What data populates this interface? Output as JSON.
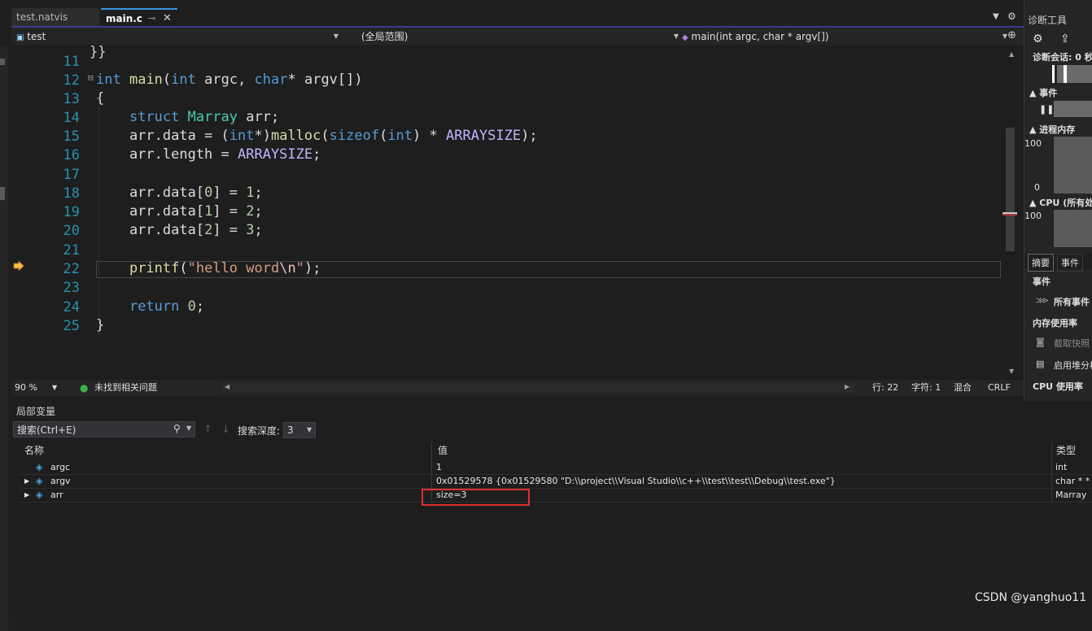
{
  "tabs": [
    {
      "label": "test.natvis",
      "active": false
    },
    {
      "label": "main.c",
      "active": true
    }
  ],
  "navbar": {
    "project": "test",
    "scope": "(全局范围)",
    "function": "main(int argc, char * argv[])"
  },
  "editor": {
    "line_numbers": [
      "11",
      "12",
      "13",
      "14",
      "15",
      "16",
      "17",
      "18",
      "19",
      "20",
      "21",
      "22",
      "23",
      "24",
      "25"
    ],
    "current_line": 22
  },
  "status": {
    "zoom": "90 %",
    "issues": "未找到相关问题",
    "line": "行: 22",
    "char": "字符: 1",
    "mixed": "混合",
    "eol": "CRLF"
  },
  "locals": {
    "title": "局部变量",
    "search_placeholder": "搜索(Ctrl+E)",
    "depth_label": "搜索深度:",
    "depth_value": "3",
    "columns": {
      "name": "名称",
      "value": "值",
      "type": "类型"
    },
    "rows": [
      {
        "name": "argc",
        "value": "1",
        "type": "int",
        "expandable": false
      },
      {
        "name": "argv",
        "value": "0x01529578 {0x01529580 \"D:\\\\project\\\\Visual Studio\\\\c++\\\\test\\\\test\\\\Debug\\\\test.exe\"}",
        "type": "char * *",
        "expandable": true
      },
      {
        "name": "arr",
        "value": "size=3",
        "type": "Marray",
        "expandable": true
      }
    ]
  },
  "diagnostics": {
    "title": "诊断工具",
    "session": "诊断会话: 0 秒",
    "events": "事件",
    "process_memory": "进程内存",
    "mem_max": "100",
    "mem_min": "0",
    "cpu": "CPU (所有处理器)",
    "cpu_max": "100",
    "tab_summary": "摘要",
    "tab_events": "事件",
    "section_events": "事件",
    "all_events": "所有事件",
    "memory_usage": "内存使用率",
    "take_snapshot": "截取快照",
    "enable_heap": "启用堆分析",
    "cpu_usage": "CPU 使用率"
  },
  "watermark": "CSDN @yanghuo11",
  "colors": {
    "accent": "#3a96dd",
    "highlight_box": "#e03030"
  }
}
